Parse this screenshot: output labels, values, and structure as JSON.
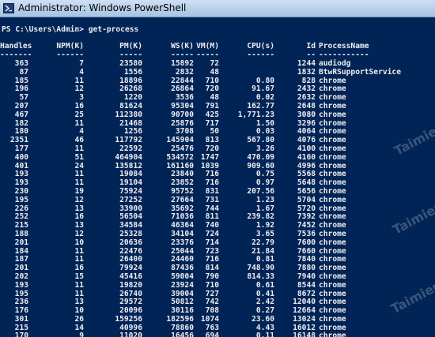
{
  "window": {
    "title": "Administrator: Windows PowerShell"
  },
  "console": {
    "prompt": "PS C:\\Users\\Admin> get-process",
    "headers": {
      "handles": "Handles",
      "npm": "NPM(K)",
      "pm": "PM(K)",
      "ws": "WS(K)",
      "vm": "VM(M)",
      "cpu": "CPU(s)",
      "id": "Id",
      "name": "ProcessName"
    },
    "separators": {
      "handles": "-------",
      "npm": "------",
      "pm": "-----",
      "ws": "-----",
      "vm": "-----",
      "cpu": "------",
      "id": "--",
      "name": "-----------"
    },
    "rows": [
      {
        "handles": "363",
        "npm": "7",
        "pm": "23580",
        "ws": "15892",
        "vm": "72",
        "cpu": "",
        "id": "1244",
        "name": "audiodg"
      },
      {
        "handles": "87",
        "npm": "4",
        "pm": "1556",
        "ws": "2832",
        "vm": "48",
        "cpu": "",
        "id": "1832",
        "name": "BtwRSupportService"
      },
      {
        "handles": "185",
        "npm": "11",
        "pm": "18896",
        "ws": "22844",
        "vm": "710",
        "cpu": "0.80",
        "id": "828",
        "name": "chrome"
      },
      {
        "handles": "196",
        "npm": "12",
        "pm": "26268",
        "ws": "26864",
        "vm": "720",
        "cpu": "91.67",
        "id": "2432",
        "name": "chrome"
      },
      {
        "handles": "57",
        "npm": "3",
        "pm": "1220",
        "ws": "3536",
        "vm": "48",
        "cpu": "0.02",
        "id": "2632",
        "name": "chrome"
      },
      {
        "handles": "207",
        "npm": "16",
        "pm": "81624",
        "ws": "95304",
        "vm": "791",
        "cpu": "162.77",
        "id": "2648",
        "name": "chrome"
      },
      {
        "handles": "467",
        "npm": "25",
        "pm": "112380",
        "ws": "90700",
        "vm": "425",
        "cpu": "1,771.23",
        "id": "3080",
        "name": "chrome"
      },
      {
        "handles": "182",
        "npm": "11",
        "pm": "21468",
        "ws": "25876",
        "vm": "717",
        "cpu": "1.50",
        "id": "3296",
        "name": "chrome"
      },
      {
        "handles": "180",
        "npm": "4",
        "pm": "1256",
        "ws": "3708",
        "vm": "50",
        "cpu": "0.03",
        "id": "4064",
        "name": "chrome"
      },
      {
        "handles": "2351",
        "npm": "46",
        "pm": "117792",
        "ws": "145904",
        "vm": "813",
        "cpu": "567.80",
        "id": "4076",
        "name": "chrome"
      },
      {
        "handles": "177",
        "npm": "11",
        "pm": "22592",
        "ws": "25476",
        "vm": "720",
        "cpu": "3.26",
        "id": "4100",
        "name": "chrome"
      },
      {
        "handles": "400",
        "npm": "51",
        "pm": "464904",
        "ws": "534572",
        "vm": "1747",
        "cpu": "470.09",
        "id": "4160",
        "name": "chrome"
      },
      {
        "handles": "401",
        "npm": "24",
        "pm": "135812",
        "ws": "161160",
        "vm": "1039",
        "cpu": "909.60",
        "id": "4996",
        "name": "chrome"
      },
      {
        "handles": "193",
        "npm": "11",
        "pm": "19084",
        "ws": "23840",
        "vm": "716",
        "cpu": "0.75",
        "id": "5568",
        "name": "chrome"
      },
      {
        "handles": "193",
        "npm": "11",
        "pm": "19104",
        "ws": "23852",
        "vm": "716",
        "cpu": "0.97",
        "id": "5648",
        "name": "chrome"
      },
      {
        "handles": "230",
        "npm": "19",
        "pm": "75924",
        "ws": "95752",
        "vm": "831",
        "cpu": "207.56",
        "id": "5656",
        "name": "chrome"
      },
      {
        "handles": "195",
        "npm": "12",
        "pm": "27252",
        "ws": "27664",
        "vm": "731",
        "cpu": "1.23",
        "id": "5704",
        "name": "chrome"
      },
      {
        "handles": "226",
        "npm": "13",
        "pm": "33900",
        "ws": "35692",
        "vm": "744",
        "cpu": "1.67",
        "id": "5720",
        "name": "chrome"
      },
      {
        "handles": "252",
        "npm": "16",
        "pm": "56504",
        "ws": "71036",
        "vm": "811",
        "cpu": "239.82",
        "id": "7392",
        "name": "chrome"
      },
      {
        "handles": "215",
        "npm": "13",
        "pm": "34584",
        "ws": "46364",
        "vm": "740",
        "cpu": "1.92",
        "id": "7452",
        "name": "chrome"
      },
      {
        "handles": "188",
        "npm": "12",
        "pm": "25328",
        "ws": "34104",
        "vm": "724",
        "cpu": "3.65",
        "id": "7536",
        "name": "chrome"
      },
      {
        "handles": "201",
        "npm": "10",
        "pm": "20636",
        "ws": "23376",
        "vm": "714",
        "cpu": "22.79",
        "id": "7600",
        "name": "chrome"
      },
      {
        "handles": "184",
        "npm": "11",
        "pm": "22476",
        "ws": "25044",
        "vm": "723",
        "cpu": "21.84",
        "id": "7660",
        "name": "chrome"
      },
      {
        "handles": "187",
        "npm": "11",
        "pm": "26400",
        "ws": "24460",
        "vm": "716",
        "cpu": "0.81",
        "id": "7840",
        "name": "chrome"
      },
      {
        "handles": "201",
        "npm": "16",
        "pm": "79924",
        "ws": "87436",
        "vm": "814",
        "cpu": "748.90",
        "id": "7880",
        "name": "chrome"
      },
      {
        "handles": "202",
        "npm": "15",
        "pm": "45416",
        "ws": "59004",
        "vm": "790",
        "cpu": "814.33",
        "id": "7940",
        "name": "chrome"
      },
      {
        "handles": "193",
        "npm": "11",
        "pm": "19820",
        "ws": "23924",
        "vm": "710",
        "cpu": "0.61",
        "id": "8544",
        "name": "chrome"
      },
      {
        "handles": "195",
        "npm": "11",
        "pm": "26740",
        "ws": "39004",
        "vm": "727",
        "cpu": "0.41",
        "id": "8672",
        "name": "chrome"
      },
      {
        "handles": "236",
        "npm": "13",
        "pm": "29572",
        "ws": "50812",
        "vm": "742",
        "cpu": "2.42",
        "id": "12040",
        "name": "chrome"
      },
      {
        "handles": "176",
        "npm": "10",
        "pm": "20096",
        "ws": "30116",
        "vm": "708",
        "cpu": "0.27",
        "id": "12664",
        "name": "chrome"
      },
      {
        "handles": "301",
        "npm": "26",
        "pm": "159256",
        "ws": "182596",
        "vm": "1074",
        "cpu": "23.60",
        "id": "13024",
        "name": "chrome"
      },
      {
        "handles": "215",
        "npm": "14",
        "pm": "40996",
        "ws": "78860",
        "vm": "763",
        "cpu": "4.43",
        "id": "16012",
        "name": "chrome"
      },
      {
        "handles": "170",
        "npm": "9",
        "pm": "11020",
        "ws": "16456",
        "vm": "694",
        "cpu": "0.11",
        "id": "16148",
        "name": "chrome"
      }
    ]
  },
  "watermark": {
    "text_1": "Taimienphi",
    "text_2": "Taimienphi",
    "text_3": "Taimienphi"
  },
  "colors": {
    "console_bg": "#012456",
    "console_fg": "#eeedf0",
    "titlebar": "#b9d1ea"
  },
  "icons": {
    "app_icon": "powershell-icon"
  }
}
